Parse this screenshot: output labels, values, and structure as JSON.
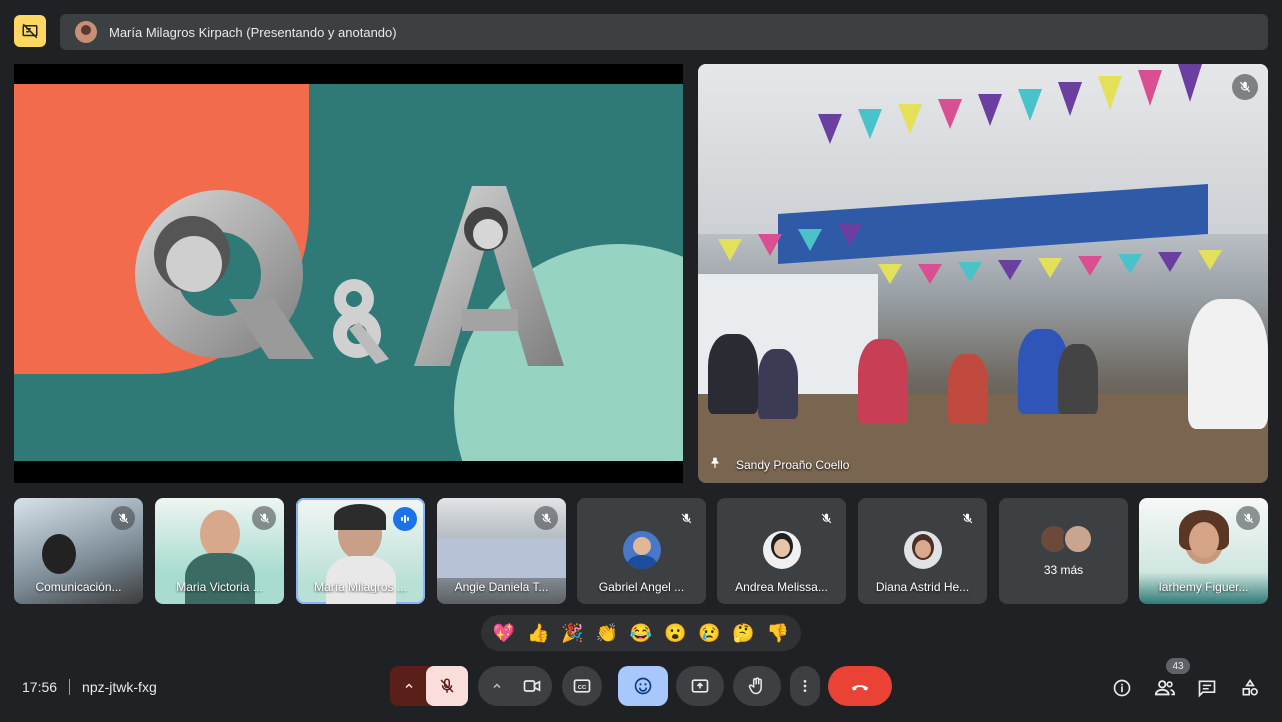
{
  "presenter": {
    "label": "María Milagros Kirpach (Presentando y anotando)"
  },
  "pinned": {
    "name": "Sandy Proaño Coello"
  },
  "tiles": [
    {
      "name": "Comunicación..."
    },
    {
      "name": "Maria Victoria ..."
    },
    {
      "name": "María Milagros ..."
    },
    {
      "name": "Angie Daniela T..."
    },
    {
      "name": "Gabriel Angel ..."
    },
    {
      "name": "Andrea Melissa..."
    },
    {
      "name": "Diana Astrid He..."
    },
    {
      "name": "33 más"
    },
    {
      "name": "Iarhemy Figuer..."
    }
  ],
  "reactions": [
    "💖",
    "👍",
    "🎉",
    "👏",
    "😂",
    "😮",
    "😢",
    "🤔",
    "👎"
  ],
  "meeting": {
    "time": "17:56",
    "code": "npz-jtwk-fxg"
  },
  "people_count": "43",
  "colors": {
    "background": "#202124",
    "hangup": "#ea4335",
    "mic_muted": "#f9dedc",
    "emoji_active": "#a8c7fa",
    "present_highlight": "#fdd663"
  }
}
